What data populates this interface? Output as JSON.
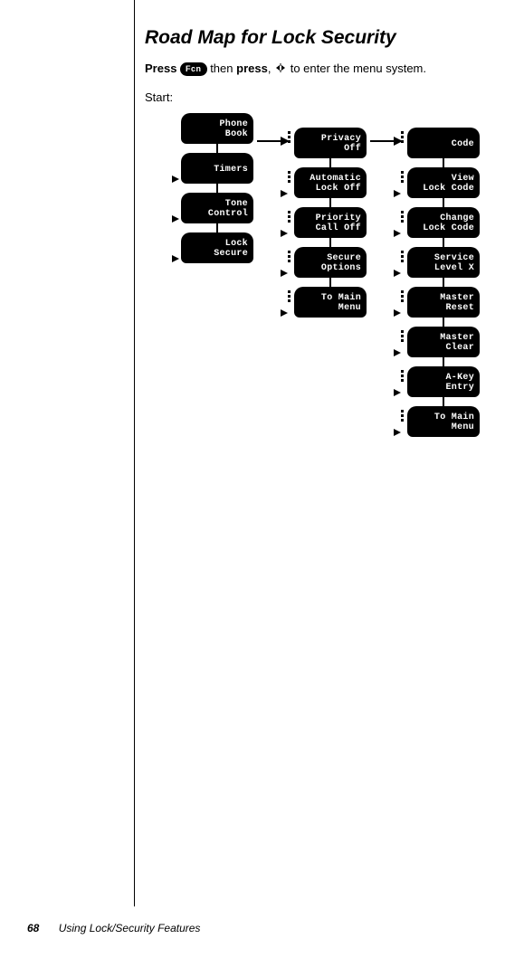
{
  "title": "Road Map for Lock Security",
  "instruction": {
    "press1": "Press",
    "fcn": "Fcn",
    "then": "then",
    "press2": "press",
    "comma": ",",
    "rest": "to enter the menu system."
  },
  "start_label": "Start:",
  "columns": {
    "c1": [
      {
        "l1": "Phone",
        "l2": "Book"
      },
      {
        "l1": "Timers",
        "l2": ""
      },
      {
        "l1": "Tone",
        "l2": "Control"
      },
      {
        "l1": "Lock",
        "l2": "Secure"
      }
    ],
    "c2": [
      {
        "l1": "Privacy",
        "l2": "Off"
      },
      {
        "l1": "Automatic",
        "l2": "Lock Off"
      },
      {
        "l1": "Priority",
        "l2": "Call Off"
      },
      {
        "l1": "Secure",
        "l2": "Options"
      },
      {
        "l1": "To Main",
        "l2": "Menu"
      }
    ],
    "c3": [
      {
        "l1": "Code",
        "l2": ""
      },
      {
        "l1": "View",
        "l2": "Lock Code"
      },
      {
        "l1": "Change",
        "l2": "Lock Code"
      },
      {
        "l1": "Service",
        "l2": "Level X"
      },
      {
        "l1": "Master",
        "l2": "Reset"
      },
      {
        "l1": "Master",
        "l2": "Clear"
      },
      {
        "l1": "A-Key",
        "l2": "Entry"
      },
      {
        "l1": "To Main",
        "l2": "Menu"
      }
    ]
  },
  "footer": {
    "page": "68",
    "section": "Using Lock/Security Features"
  }
}
